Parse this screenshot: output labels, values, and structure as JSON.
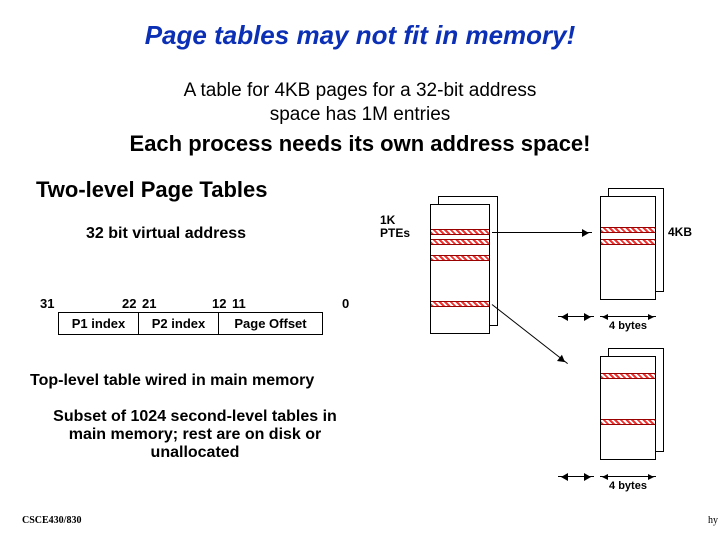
{
  "title": "Page tables may not fit in memory!",
  "sub1_line1": "A table for 4KB pages for a 32-bit address",
  "sub1_line2": "space has 1M entries",
  "sub2": "Each process needs its own address space!",
  "section_title": "Two-level Page Tables",
  "vaddr_label": "32 bit virtual address",
  "bits": {
    "b31": "31",
    "b22": "22",
    "b21": "21",
    "b12": "12",
    "b11": "11",
    "b0": "0"
  },
  "fields": {
    "p1": "P1 index",
    "p2": "P2 index",
    "off": "Page Offset"
  },
  "body1": "Top-level table wired in main memory",
  "body2_l1": "Subset of 1024 second-level tables in",
  "body2_l2": "main memory; rest are on disk or",
  "body2_l3": "unallocated",
  "diagram": {
    "ptes_label_l1": "1K",
    "ptes_label_l2": "PTEs",
    "size_label": "4KB",
    "bytes_label": "4 bytes",
    "bytes_label2": "4 bytes"
  },
  "footer": {
    "left": "CSCE430/830",
    "right": "hy"
  }
}
